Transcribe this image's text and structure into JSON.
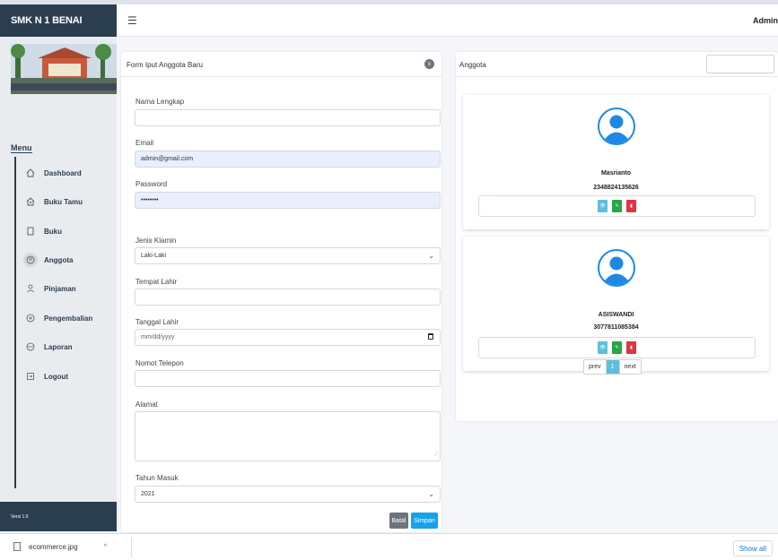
{
  "sidebar": {
    "brand": "SMK N 1 BENAI",
    "menu_title": "Menu",
    "items": [
      {
        "label": "Dashboard",
        "icon": "home-icon"
      },
      {
        "label": "Buku Tamu",
        "icon": "guestbook-icon"
      },
      {
        "label": "Buku",
        "icon": "book-icon"
      },
      {
        "label": "Anggota",
        "icon": "users-icon",
        "active": true
      },
      {
        "label": "Pinjaman",
        "icon": "loan-icon"
      },
      {
        "label": "Pengembalian",
        "icon": "return-icon"
      },
      {
        "label": "Laporan",
        "icon": "report-icon"
      },
      {
        "label": "Logout",
        "icon": "logout-icon"
      }
    ],
    "version": "Versi 1.0"
  },
  "header": {
    "menu_icon": "hamburger-icon",
    "user": "Admin"
  },
  "form": {
    "title": "Form Iput Anggota Baru",
    "collapse_icon": "x",
    "fields": {
      "nama_label": "Nama Lengkap",
      "nama_value": "",
      "email_label": "Email",
      "email_value": "admin@gmail.com",
      "password_label": "Password",
      "password_value": "••••••••",
      "jk_label": "Jenis Klamin",
      "jk_value": "Laki-Laki",
      "tempat_label": "Tempat Lahir",
      "tempat_value": "",
      "tanggal_label": "Tanggal Lahir",
      "tanggal_value": "mm/dd/yyyy",
      "telepon_label": "Nomot Telepon",
      "telepon_value": "",
      "alamat_label": "Alamat",
      "alamat_value": "",
      "tahun_label": "Tahun Masuk",
      "tahun_value": "2021"
    },
    "buttons": {
      "cancel": "Batal",
      "save": "Simpan"
    }
  },
  "members": {
    "title": "Anggota",
    "search_value": "",
    "list": [
      {
        "name": "Masrianto",
        "id": "2348824135626"
      },
      {
        "name": "ASISWANDI",
        "id": "3077811085384"
      }
    ],
    "action_icons": [
      "eye-icon",
      "edit-icon",
      "trash-icon"
    ],
    "colors": {
      "view": "#5bc0de",
      "edit": "#28a745",
      "delete": "#dc3545",
      "avatar": "#1e88e5"
    },
    "pagination": {
      "prev": "prev",
      "current": "1",
      "next": "next"
    }
  },
  "downloads": {
    "file": "ecommerce.jpg",
    "show_all": "Show all"
  }
}
